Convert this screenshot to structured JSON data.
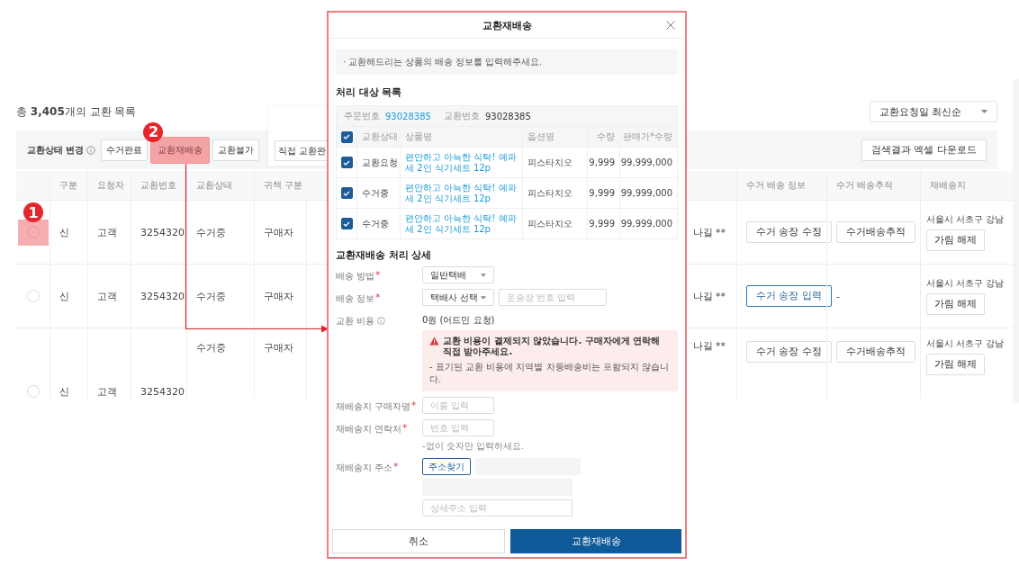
{
  "list_header": {
    "title": "총 **3,405**개의 교환 목록",
    "sort": "교환요청일 최신순"
  },
  "toolbar": {
    "label": "교환상태 변경",
    "buttons": [
      {
        "label": "수거완료",
        "highlighted": false
      },
      {
        "label": "교환재배송",
        "highlighted": true,
        "badge": "2"
      },
      {
        "label": "교환불가",
        "highlighted": false
      }
    ],
    "popover_button": "직접 교환완",
    "download": "검색결과 엑셀 다운로드"
  },
  "table": {
    "columns_left": [
      "구분",
      "요청자",
      "교환번호",
      "교환상태",
      "귀책 구분"
    ],
    "columns_right": [
      "수거 배송 정보",
      "수거 배송추적",
      "재배송지"
    ],
    "rows": [
      {
        "kind": "single",
        "selected": false,
        "highlighted": true,
        "badge": "1",
        "type": "신",
        "requester": "고객",
        "exchange_no": "3254320",
        "status": "수거중",
        "fault": "구매자",
        "address_tail": "나길 **",
        "pickup": {
          "label": "수거 송장 수정",
          "primary": false
        },
        "tracking": {
          "kind": "button",
          "label": "수거배송추적"
        },
        "reship_address": "서울시 서초구 강남",
        "unmask": "가림 해제"
      },
      {
        "kind": "single",
        "selected": false,
        "highlighted": false,
        "type": "신",
        "requester": "고객",
        "exchange_no": "3254320",
        "status": "수거중",
        "fault": "구매자",
        "address_tail": "나길 **",
        "pickup": {
          "label": "수거 송장 입력",
          "primary": true
        },
        "tracking": {
          "kind": "text",
          "label": "-"
        },
        "reship_address": "서울시 서초구 강남",
        "unmask": "가림 해제"
      },
      {
        "kind": "merged",
        "selected": false,
        "highlighted": false,
        "type": "신",
        "requester": "고객",
        "exchange_no": "3254320",
        "status": "수거중",
        "fault": "구매자",
        "address_tail": "나길 **",
        "pickup": {
          "label": "수거 송장 수정",
          "primary": false
        },
        "tracking": {
          "kind": "button",
          "label": "수거배송추적"
        },
        "reship_address": "서울시 서초구 강남",
        "unmask": "가림 해제"
      }
    ]
  },
  "modal": {
    "title": "교환재배송",
    "notice": "· 교환해드리는 상품의 배송 정보를 입력해주세요.",
    "targets_title": "처리 대상 목록",
    "order_label": "주문번호",
    "order_no": "93028385",
    "exchange_label": "교환번호",
    "exchange_no": "93028385",
    "all_checked": true,
    "columns": [
      "교환상태",
      "상품명",
      "옵션명",
      "수량",
      "판매가*수량"
    ],
    "items": [
      {
        "checked": true,
        "status": "교환요청",
        "product": "편안하고 아늑한 식탁! 예파세 2인 식기세트 12p",
        "option": "피스타치오",
        "qty": "9,999",
        "amount": "99,999,000"
      },
      {
        "checked": true,
        "status": "수거중",
        "product": "편안하고 아늑한 식탁! 예파세 2인 식기세트 12p",
        "option": "피스타치오",
        "qty": "9,999",
        "amount": "99,999,000"
      },
      {
        "checked": true,
        "status": "수거중",
        "product": "편안하고 아늑한 식탁! 예파세 2인 식기세트 12p",
        "option": "피스타치오",
        "qty": "9,999",
        "amount": "99,999,000"
      }
    ],
    "detail_title": "교환재배송 처리 상세",
    "fields": [
      {
        "kind": "select",
        "label": "배송 방법",
        "mark": "*",
        "value": "일반택배"
      },
      {
        "kind": "select_input",
        "label": "배송 정보",
        "mark": "*",
        "value": "택배사 선택",
        "placeholder": "운송장 번호 입력"
      },
      {
        "kind": "cost",
        "label": "교환 비용",
        "value": "0원 (어드민 요청)",
        "warning": "교환 비용이 결제되지 않았습니다. 구매자에게 연락해 직접 받아주세요.",
        "note": "- 표기된 교환 비용에 지역별 차등배송비는 포함되지 않습니다."
      },
      {
        "kind": "input",
        "label": "재배송지 구매자명",
        "mark": "*",
        "placeholder": "이름 입력"
      },
      {
        "kind": "input",
        "label": "재배송지 연락처",
        "mark": "*",
        "placeholder": "번호 입력",
        "hint": "-없이 숫자만 입력하세요."
      },
      {
        "kind": "address",
        "label": "재배송지 주소",
        "mark": "*",
        "button": "주소찾기",
        "placeholder": "상세주소 입력"
      }
    ],
    "cancel": "취소",
    "confirm": "교환재배송"
  }
}
